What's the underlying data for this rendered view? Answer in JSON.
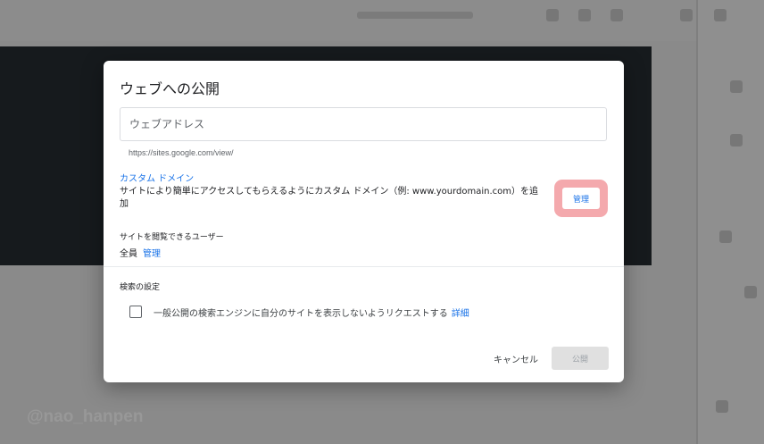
{
  "dialog": {
    "title": "ウェブへの公開",
    "web_address": {
      "placeholder": "ウェブアドレス",
      "value": "",
      "hint": "https://sites.google.com/view/"
    },
    "custom_domain": {
      "title": "カスタム ドメイン",
      "description": "サイトにより簡単にアクセスしてもらえるようにカスタム ドメイン（例: www.yourdomain.com）を追加",
      "manage_label": "管理"
    },
    "viewers": {
      "title": "サイトを閲覧できるユーザー",
      "value": "全員",
      "manage_label": "管理"
    },
    "search": {
      "title": "検索の設定",
      "checkbox_label": "一般公開の検索エンジンに自分のサイトを表示しないようリクエストする",
      "details_label": "詳細",
      "checked": false
    },
    "buttons": {
      "cancel": "キャンセル",
      "publish": "公開"
    }
  },
  "watermark": "@nao_hanpen",
  "colors": {
    "accent": "#1a73e8",
    "highlight": "#f4a9ad",
    "disabled_button": "#e0e0e0"
  }
}
